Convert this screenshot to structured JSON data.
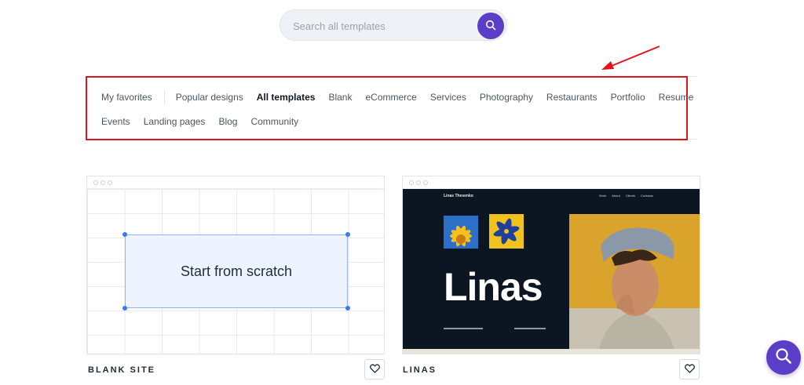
{
  "search": {
    "placeholder": "Search all templates",
    "button_icon": "search-icon",
    "accent_color": "#5a3ec8"
  },
  "categories": {
    "row1": [
      "My favorites",
      "Popular designs",
      "All templates",
      "Blank",
      "eCommerce",
      "Services",
      "Photography",
      "Restaurants",
      "Portfolio",
      "Resume"
    ],
    "row2": [
      "Events",
      "Landing pages",
      "Blog",
      "Community"
    ],
    "active": "All templates"
  },
  "cards": [
    {
      "label": "BLANK SITE",
      "preview_text": "Start from scratch",
      "favorite_icon": "heart-icon"
    },
    {
      "label": "LINAS",
      "preview": {
        "site_name": "Linas Thesenko",
        "nav": [
          "Work",
          "About",
          "Clients",
          "Contacts"
        ],
        "title": "Linas"
      },
      "favorite_icon": "heart-icon"
    }
  ],
  "help": {
    "icon": "search-help-icon"
  },
  "annotation": {
    "color": "#e0141c"
  }
}
